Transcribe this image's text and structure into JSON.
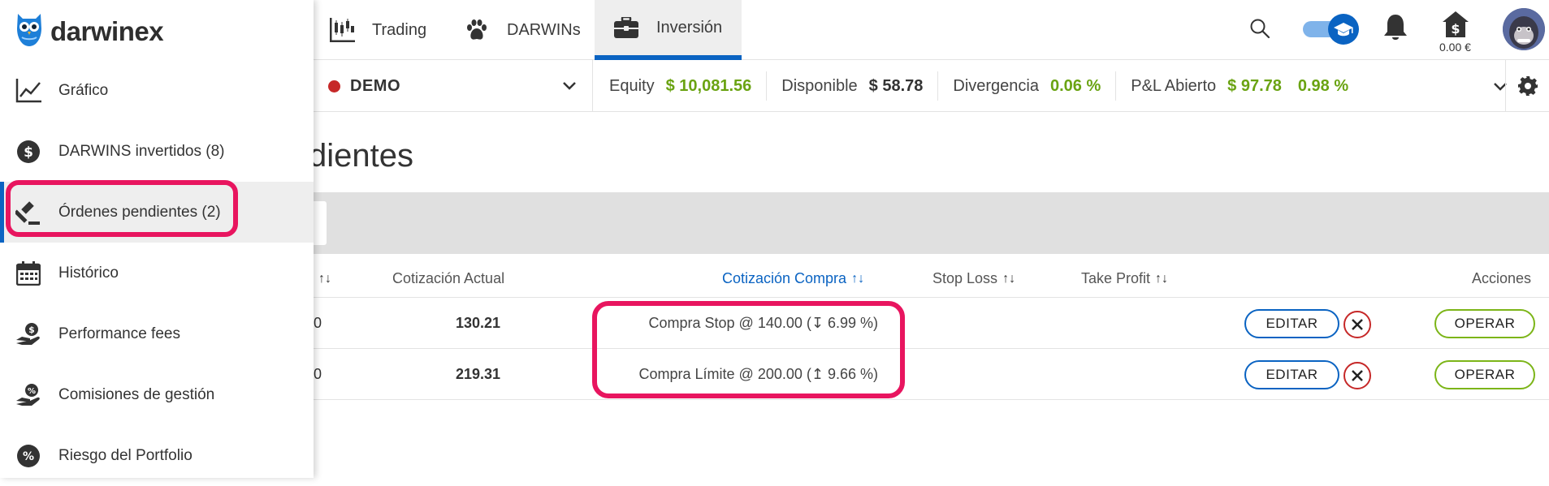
{
  "app": {
    "brand": "darwinex"
  },
  "topnav": {
    "tabs": [
      {
        "label": "Trading",
        "icon": "candlestick-chart-icon"
      },
      {
        "label": "DARWINs",
        "icon": "paw-icon"
      },
      {
        "label": "Inversión",
        "icon": "briefcase-icon",
        "active": true
      }
    ],
    "balance": "0.00 €",
    "toggle_on": true
  },
  "account": {
    "name": "DEMO",
    "status_color": "#c62828",
    "metrics": [
      {
        "label": "Equity",
        "values": [
          "$ 10,081.56"
        ],
        "color": "green"
      },
      {
        "label": "Disponible",
        "values": [
          "$ 58.78"
        ],
        "color": "dark"
      },
      {
        "label": "Divergencia",
        "values": [
          "0.06 %"
        ],
        "color": "green"
      },
      {
        "label": "P&L Abierto",
        "values": [
          "$ 97.78",
          "0.98 %"
        ],
        "color": "green"
      }
    ]
  },
  "page": {
    "title_visible": "dientes"
  },
  "table": {
    "headers": {
      "col1_arrows": "↑↓",
      "current_price": "Cotización Actual",
      "buy_price": "Cotización Compra",
      "stop_loss": "Stop Loss",
      "take_profit": "Take Profit",
      "actions": "Acciones",
      "sort_arrows": "↑↓"
    },
    "rows": [
      {
        "col1": ")0",
        "current": "130.21",
        "order": "Compra Stop @ 140.00 (↧ 6.99 %)",
        "edit": "EDITAR",
        "trade": "OPERAR"
      },
      {
        "col1": ")0",
        "current": "219.31",
        "order": "Compra Límite @ 200.00 (↥ 9.66 %)",
        "edit": "EDITAR",
        "trade": "OPERAR"
      }
    ]
  },
  "sidebar": {
    "items": [
      {
        "label": "Gráfico",
        "icon": "line-chart-icon"
      },
      {
        "label": "DARWINS invertidos (8)",
        "icon": "dollar-circle-icon"
      },
      {
        "label": "Órdenes pendientes (2)",
        "icon": "gavel-icon",
        "active": true
      },
      {
        "label": "Histórico",
        "icon": "calendar-icon"
      },
      {
        "label": "Performance fees",
        "icon": "hand-coin-icon"
      },
      {
        "label": "Comisiones de gestión",
        "icon": "hand-percent-icon"
      },
      {
        "label": "Riesgo del Portfolio",
        "icon": "percent-circle-icon"
      }
    ]
  },
  "colors": {
    "accent": "#0a63c2",
    "positive": "#6aa312",
    "highlight": "#e8155f",
    "danger": "#c62828"
  }
}
